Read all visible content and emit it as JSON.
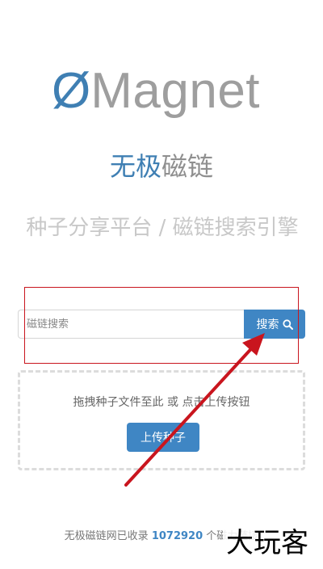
{
  "logo": {
    "symbol": "Ø",
    "text": "Magnet"
  },
  "subtitle": {
    "part1": "无极",
    "part2": "磁链"
  },
  "tagline": "种子分享平台 / 磁链搜索引擎",
  "search": {
    "placeholder": "磁链搜索",
    "button_label": "搜索"
  },
  "upload": {
    "hint": "拖拽种子文件至此 或 点击上传按钮",
    "button_label": "上传种子"
  },
  "footer": {
    "prefix": "无极磁链网已收录",
    "count": "1072920",
    "suffix": "个磁力链接"
  },
  "watermark": "大玩客",
  "colors": {
    "brand_blue": "#3f7fb3",
    "button_blue": "#3f86c4",
    "annotation_red": "#c9151e"
  }
}
